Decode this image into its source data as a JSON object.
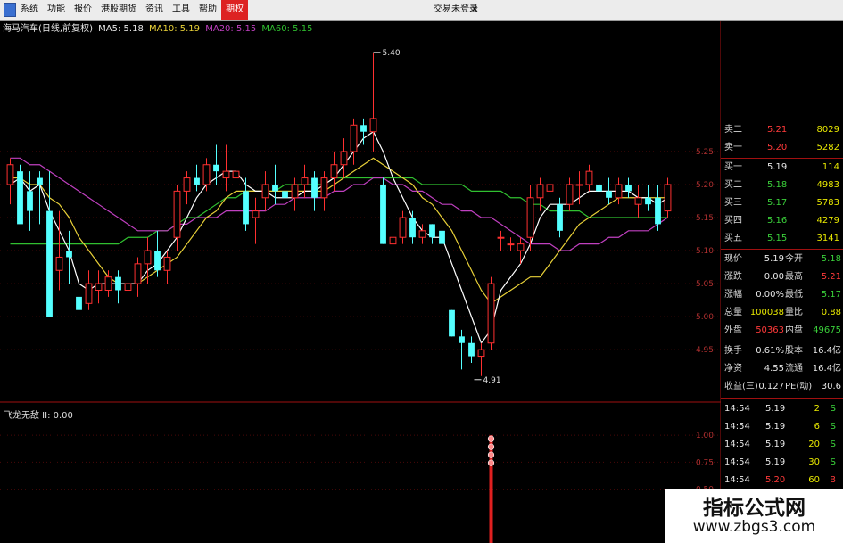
{
  "menu": {
    "items": [
      "系统",
      "功能",
      "报价",
      "港股期货",
      "资讯",
      "工具",
      "帮助",
      "期权"
    ],
    "active_index": 7,
    "login_text": "交易未登录",
    "close_glyph": "×"
  },
  "indicator": {
    "title": "海马汽车(日线,前复权)",
    "ma5_label": "MA5: 5.18",
    "ma10_label": "MA10: 5.19",
    "ma20_label": "MA20: 5.15",
    "ma60_label": "MA60: 5.15",
    "colors": {
      "ma5": "#ffffff",
      "ma10": "#e8d038",
      "ma20": "#c040c0",
      "ma60": "#30c030"
    }
  },
  "sub_indicator": {
    "title": "飞龙无敌 II: 0.00"
  },
  "chart_data": {
    "type": "candlestick",
    "price_axis": {
      "ticks": [
        "5.25",
        "5.20",
        "5.15",
        "5.10",
        "5.05",
        "5.00",
        "4.95"
      ],
      "range": [
        4.88,
        5.42
      ]
    },
    "sub_axis": {
      "ticks": [
        "1.00",
        "0.75",
        "0.50"
      ],
      "range": [
        0,
        1.2
      ]
    },
    "annotations": {
      "high": "5.40",
      "low": "4.91"
    },
    "candles": [
      [
        5.2,
        5.24,
        5.17,
        5.23
      ],
      [
        5.22,
        5.23,
        5.15,
        5.14
      ],
      [
        5.19,
        5.22,
        5.13,
        5.16
      ],
      [
        5.21,
        5.22,
        5.14,
        5.2
      ],
      [
        5.16,
        5.22,
        5.0,
        5.0
      ],
      [
        5.07,
        5.16,
        5.04,
        5.09
      ],
      [
        5.1,
        5.13,
        5.05,
        5.09
      ],
      [
        5.03,
        5.06,
        4.97,
        5.01
      ],
      [
        5.02,
        5.07,
        5.01,
        5.05
      ],
      [
        5.04,
        5.07,
        5.02,
        5.05
      ],
      [
        5.04,
        5.07,
        5.03,
        5.06
      ],
      [
        5.06,
        5.07,
        5.02,
        5.04
      ],
      [
        5.04,
        5.06,
        5.01,
        5.05
      ],
      [
        5.05,
        5.09,
        5.03,
        5.08
      ],
      [
        5.08,
        5.12,
        5.05,
        5.1
      ],
      [
        5.1,
        5.13,
        5.06,
        5.07
      ],
      [
        5.07,
        5.1,
        5.05,
        5.09
      ],
      [
        5.12,
        5.2,
        5.1,
        5.19
      ],
      [
        5.19,
        5.22,
        5.17,
        5.21
      ],
      [
        5.21,
        5.23,
        5.19,
        5.2
      ],
      [
        5.2,
        5.24,
        5.19,
        5.23
      ],
      [
        5.23,
        5.26,
        5.2,
        5.22
      ],
      [
        5.21,
        5.26,
        5.19,
        5.22
      ],
      [
        5.21,
        5.23,
        5.19,
        5.22
      ],
      [
        5.19,
        5.21,
        5.13,
        5.14
      ],
      [
        5.15,
        5.18,
        5.11,
        5.16
      ],
      [
        5.18,
        5.22,
        5.16,
        5.2
      ],
      [
        5.2,
        5.23,
        5.17,
        5.19
      ],
      [
        5.19,
        5.2,
        5.17,
        5.18
      ],
      [
        5.18,
        5.21,
        5.16,
        5.2
      ],
      [
        5.2,
        5.23,
        5.18,
        5.21
      ],
      [
        5.21,
        5.22,
        5.16,
        5.18
      ],
      [
        5.18,
        5.22,
        5.16,
        5.21
      ],
      [
        5.21,
        5.25,
        5.19,
        5.23
      ],
      [
        5.23,
        5.27,
        5.21,
        5.25
      ],
      [
        5.25,
        5.3,
        5.23,
        5.29
      ],
      [
        5.29,
        5.3,
        5.26,
        5.28
      ],
      [
        5.28,
        5.4,
        5.25,
        5.3
      ],
      [
        5.2,
        5.21,
        5.11,
        5.11
      ],
      [
        5.11,
        5.13,
        5.1,
        5.12
      ],
      [
        5.12,
        5.16,
        5.11,
        5.15
      ],
      [
        5.15,
        5.16,
        5.11,
        5.12
      ],
      [
        5.12,
        5.14,
        5.11,
        5.13
      ],
      [
        5.14,
        5.14,
        5.11,
        5.12
      ],
      [
        5.13,
        5.13,
        5.1,
        5.11
      ],
      [
        5.01,
        5.01,
        4.97,
        4.97
      ],
      [
        4.97,
        4.98,
        4.92,
        4.96
      ],
      [
        4.96,
        4.97,
        4.93,
        4.94
      ],
      [
        4.94,
        4.96,
        4.91,
        4.95
      ],
      [
        4.96,
        5.06,
        4.95,
        5.05
      ],
      [
        5.12,
        5.13,
        5.1,
        5.12
      ],
      [
        5.11,
        5.12,
        5.1,
        5.11
      ],
      [
        5.1,
        5.12,
        5.08,
        5.11
      ],
      [
        5.12,
        5.2,
        5.1,
        5.18
      ],
      [
        5.18,
        5.21,
        5.16,
        5.2
      ],
      [
        5.19,
        5.22,
        5.18,
        5.2
      ],
      [
        5.17,
        5.18,
        5.12,
        5.13
      ],
      [
        5.17,
        5.21,
        5.16,
        5.2
      ],
      [
        5.2,
        5.22,
        5.17,
        5.2
      ],
      [
        5.2,
        5.23,
        5.19,
        5.22
      ],
      [
        5.2,
        5.22,
        5.18,
        5.19
      ],
      [
        5.19,
        5.21,
        5.17,
        5.18
      ],
      [
        5.18,
        5.21,
        5.17,
        5.2
      ],
      [
        5.2,
        5.21,
        5.18,
        5.19
      ],
      [
        5.17,
        5.2,
        5.15,
        5.18
      ],
      [
        5.18,
        5.2,
        5.16,
        5.17
      ],
      [
        5.18,
        5.2,
        5.13,
        5.14
      ],
      [
        5.16,
        5.21,
        5.15,
        5.2
      ]
    ],
    "ma5": [
      5.2,
      5.21,
      5.19,
      5.2,
      5.16,
      5.13,
      5.1,
      5.05,
      5.04,
      5.05,
      5.05,
      5.05,
      5.05,
      5.05,
      5.07,
      5.08,
      5.1,
      5.12,
      5.15,
      5.18,
      5.2,
      5.21,
      5.22,
      5.22,
      5.2,
      5.19,
      5.19,
      5.18,
      5.18,
      5.18,
      5.19,
      5.19,
      5.2,
      5.21,
      5.23,
      5.25,
      5.27,
      5.28,
      5.25,
      5.21,
      5.18,
      5.15,
      5.13,
      5.12,
      5.12,
      5.08,
      5.04,
      5.0,
      4.96,
      4.98,
      5.04,
      5.06,
      5.08,
      5.11,
      5.15,
      5.17,
      5.17,
      5.17,
      5.18,
      5.19,
      5.19,
      5.19,
      5.19,
      5.19,
      5.18,
      5.18,
      5.17,
      5.18
    ],
    "ma10": [
      5.21,
      5.21,
      5.2,
      5.2,
      5.18,
      5.17,
      5.15,
      5.12,
      5.1,
      5.08,
      5.06,
      5.05,
      5.05,
      5.05,
      5.06,
      5.07,
      5.08,
      5.09,
      5.11,
      5.13,
      5.15,
      5.16,
      5.18,
      5.19,
      5.19,
      5.19,
      5.19,
      5.19,
      5.19,
      5.19,
      5.19,
      5.19,
      5.19,
      5.2,
      5.21,
      5.22,
      5.23,
      5.24,
      5.23,
      5.22,
      5.21,
      5.2,
      5.18,
      5.17,
      5.15,
      5.13,
      5.1,
      5.07,
      5.04,
      5.02,
      5.03,
      5.04,
      5.05,
      5.06,
      5.06,
      5.08,
      5.1,
      5.12,
      5.14,
      5.15,
      5.16,
      5.17,
      5.18,
      5.18,
      5.18,
      5.18,
      5.18,
      5.18
    ],
    "ma20": [
      5.24,
      5.24,
      5.23,
      5.23,
      5.22,
      5.21,
      5.2,
      5.19,
      5.18,
      5.17,
      5.16,
      5.15,
      5.14,
      5.13,
      5.13,
      5.13,
      5.13,
      5.14,
      5.14,
      5.15,
      5.15,
      5.15,
      5.16,
      5.16,
      5.16,
      5.16,
      5.16,
      5.17,
      5.17,
      5.18,
      5.18,
      5.18,
      5.18,
      5.19,
      5.19,
      5.2,
      5.2,
      5.21,
      5.21,
      5.2,
      5.2,
      5.19,
      5.19,
      5.18,
      5.17,
      5.17,
      5.16,
      5.16,
      5.15,
      5.15,
      5.14,
      5.13,
      5.12,
      5.11,
      5.11,
      5.11,
      5.1,
      5.1,
      5.11,
      5.11,
      5.11,
      5.12,
      5.12,
      5.13,
      5.13,
      5.13,
      5.14,
      5.15
    ],
    "ma60": [
      5.11,
      5.11,
      5.11,
      5.11,
      5.11,
      5.11,
      5.11,
      5.11,
      5.11,
      5.11,
      5.11,
      5.11,
      5.12,
      5.12,
      5.12,
      5.13,
      5.13,
      5.14,
      5.15,
      5.15,
      5.16,
      5.17,
      5.18,
      5.18,
      5.19,
      5.19,
      5.19,
      5.19,
      5.2,
      5.2,
      5.2,
      5.2,
      5.2,
      5.21,
      5.21,
      5.21,
      5.21,
      5.21,
      5.21,
      5.21,
      5.21,
      5.21,
      5.2,
      5.2,
      5.2,
      5.2,
      5.2,
      5.19,
      5.19,
      5.19,
      5.19,
      5.18,
      5.18,
      5.17,
      5.17,
      5.16,
      5.16,
      5.16,
      5.16,
      5.15,
      5.15,
      5.15,
      5.15,
      5.15,
      5.15,
      5.15,
      5.15,
      5.15
    ],
    "signal_bar": {
      "index": 49,
      "value": 1.0,
      "dots": 4
    }
  },
  "panel": {
    "rows": [
      {
        "label": "卖二",
        "price": "5.21",
        "price_color": "red",
        "vol": "8029"
      },
      {
        "label": "卖一",
        "price": "5.20",
        "price_color": "red",
        "vol": "5282"
      },
      {
        "label": "买一",
        "price": "5.19",
        "price_color": "white",
        "vol": "114"
      },
      {
        "label": "买二",
        "price": "5.18",
        "price_color": "green",
        "vol": "4983"
      },
      {
        "label": "买三",
        "price": "5.17",
        "price_color": "green",
        "vol": "5783"
      },
      {
        "label": "买四",
        "price": "5.16",
        "price_color": "green",
        "vol": "4279"
      },
      {
        "label": "买五",
        "price": "5.15",
        "price_color": "green",
        "vol": "3141"
      }
    ],
    "stats": [
      {
        "l1": "现价",
        "v1": "5.19",
        "c1": "white",
        "l2": "今开",
        "v2": "5.18",
        "c2": "green"
      },
      {
        "l1": "涨跌",
        "v1": "0.00",
        "c1": "white",
        "l2": "最高",
        "v2": "5.21",
        "c2": "red"
      },
      {
        "l1": "涨幅",
        "v1": "0.00%",
        "c1": "white",
        "l2": "最低",
        "v2": "5.17",
        "c2": "green"
      },
      {
        "l1": "总量",
        "v1": "100038",
        "c1": "yellow",
        "l2": "量比",
        "v2": "0.88",
        "c2": "yellow"
      },
      {
        "l1": "外盘",
        "v1": "50363",
        "c1": "red",
        "l2": "内盘",
        "v2": "49675",
        "c2": "green"
      }
    ],
    "fund": [
      {
        "l1": "换手",
        "v1": "0.61%",
        "l2": "股本",
        "v2": "16.4亿"
      },
      {
        "l1": "净资",
        "v1": "4.55",
        "l2": "流通",
        "v2": "16.4亿"
      },
      {
        "l1": "收益(三)",
        "v1": "0.127",
        "l2": "PE(动)",
        "v2": "30.6"
      }
    ],
    "ticks": [
      {
        "time": "14:54",
        "price": "5.19",
        "vol": "2",
        "flag": "S"
      },
      {
        "time": "14:54",
        "price": "5.19",
        "vol": "6",
        "flag": "S"
      },
      {
        "time": "14:54",
        "price": "5.19",
        "vol": "20",
        "flag": "S"
      },
      {
        "time": "14:54",
        "price": "5.19",
        "vol": "30",
        "flag": "S"
      },
      {
        "time": "14:54",
        "price": "5.20",
        "vol": "60",
        "flag": "B"
      }
    ]
  },
  "watermark": {
    "title": "指标公式网",
    "url": "www.zbgs3.com"
  }
}
